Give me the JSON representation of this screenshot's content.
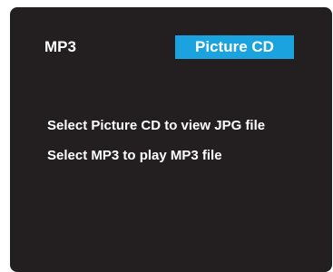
{
  "menu": {
    "options": [
      {
        "label": "MP3",
        "selected": false
      },
      {
        "label": "Picture CD",
        "selected": true
      }
    ],
    "highlight_color": "#1ba3e0",
    "background_color": "#231f20"
  },
  "messages": [
    "Select Picture CD to view JPG file",
    "Select MP3 to play MP3 file"
  ]
}
